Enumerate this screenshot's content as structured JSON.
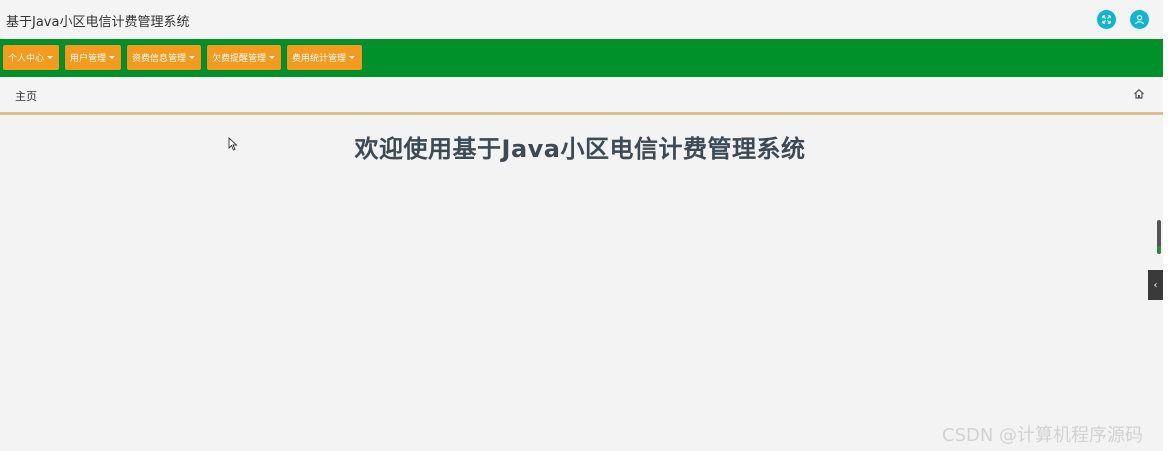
{
  "header": {
    "title": "基于Java小区电信计费管理系统",
    "fullscreen_icon": "expand-arrows-icon",
    "user_icon": "user-icon"
  },
  "nav": {
    "items": [
      {
        "label": "个人中心"
      },
      {
        "label": "用户管理"
      },
      {
        "label": "资费信息管理"
      },
      {
        "label": "欠费提醒管理"
      },
      {
        "label": "费用统计管理"
      }
    ]
  },
  "breadcrumb": {
    "label": "主页",
    "home_icon": "home-icon"
  },
  "main": {
    "welcome": "欢迎使用基于Java小区电信计费管理系统"
  },
  "watermark": "CSDN @计算机程序源码",
  "colors": {
    "nav_bg": "#00912b",
    "nav_item": "#f39a1f",
    "accent_icon": "#11b5d2",
    "divider": "#dfc08a",
    "welcome_text": "#3b4a55"
  }
}
